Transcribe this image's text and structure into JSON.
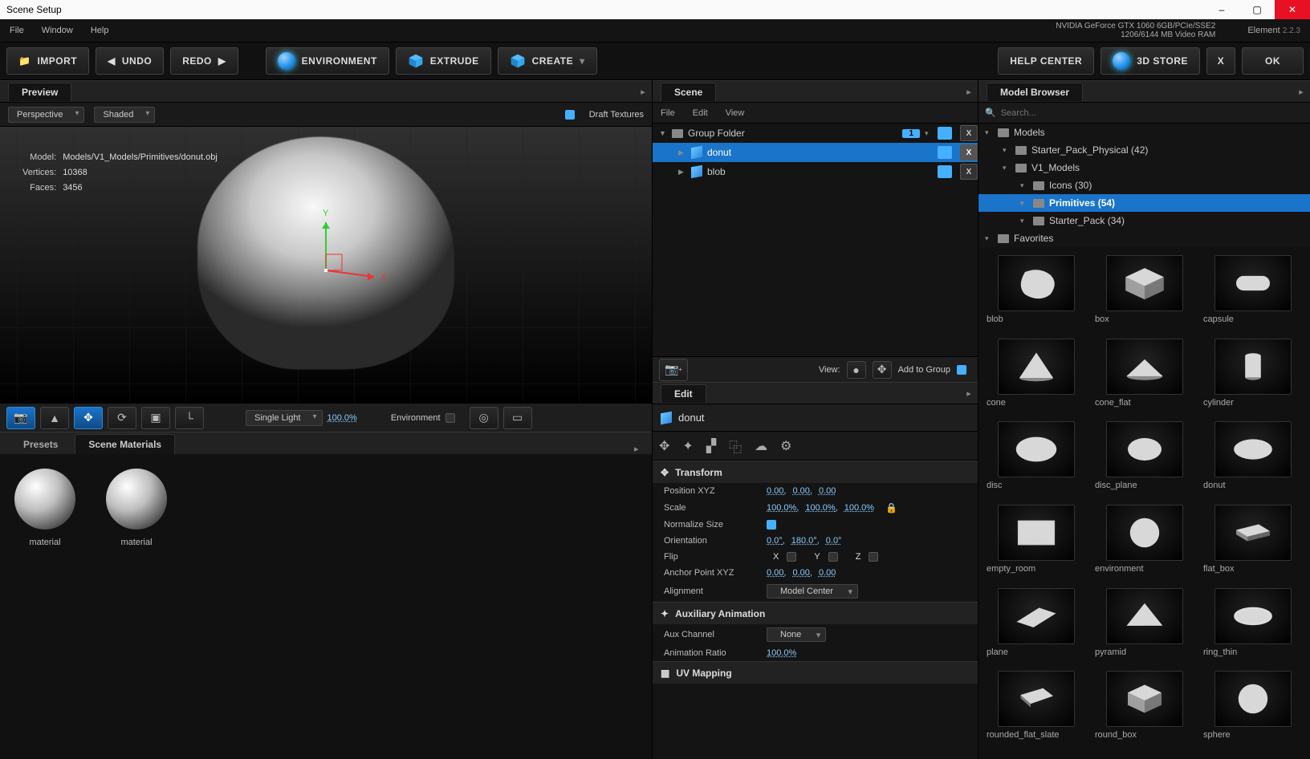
{
  "window": {
    "title": "Scene Setup"
  },
  "menubar": {
    "items": [
      "File",
      "Window",
      "Help"
    ],
    "gpu_line1": "NVIDIA GeForce GTX 1060 6GB/PCIe/SSE2",
    "gpu_line2": "1206/6144 MB Video RAM",
    "product": "Element",
    "version": "2.2.3"
  },
  "toolbar": {
    "import": "IMPORT",
    "undo": "UNDO",
    "redo": "REDO",
    "environment": "ENVIRONMENT",
    "extrude": "EXTRUDE",
    "create": "CREATE",
    "help_center": "HELP CENTER",
    "store": "3D STORE",
    "x": "X",
    "ok": "OK"
  },
  "preview": {
    "tab": "Preview",
    "view_mode": "Perspective",
    "shading": "Shaded",
    "draft_textures": "Draft Textures",
    "info": {
      "model_label": "Model:",
      "model_value": "Models/V1_Models/Primitives/donut.obj",
      "vertices_label": "Vertices:",
      "vertices_value": "10368",
      "faces_label": "Faces:",
      "faces_value": "3456"
    },
    "footer": {
      "lighting": "Single Light",
      "lighting_pct": "100.0%",
      "environment": "Environment"
    }
  },
  "bottom_tabs": {
    "presets": "Presets",
    "materials": "Scene Materials"
  },
  "materials": [
    "material",
    "material"
  ],
  "scene": {
    "tab": "Scene",
    "menu": [
      "File",
      "Edit",
      "View"
    ],
    "tree": [
      {
        "name": "Group Folder",
        "badge": "1",
        "depth": 0,
        "type": "folder",
        "selected": false
      },
      {
        "name": "donut",
        "depth": 1,
        "type": "mesh",
        "selected": true
      },
      {
        "name": "blob",
        "depth": 1,
        "type": "mesh",
        "selected": false
      }
    ],
    "footer": {
      "view": "View:",
      "add": "Add to Group"
    }
  },
  "edit": {
    "tab": "Edit",
    "object": "donut",
    "transform": {
      "header": "Transform",
      "position_label": "Position XYZ",
      "position": [
        "0.00",
        "0.00",
        "0.00"
      ],
      "scale_label": "Scale",
      "scale": [
        "100.0%",
        "100.0%",
        "100.0%"
      ],
      "normalize_label": "Normalize Size",
      "orientation_label": "Orientation",
      "orientation": [
        "0.0°",
        "180.0°",
        "0.0°"
      ],
      "flip_label": "Flip",
      "flip_axes": [
        "X",
        "Y",
        "Z"
      ],
      "anchor_label": "Anchor Point XYZ",
      "anchor": [
        "0.00",
        "0.00",
        "0.00"
      ],
      "alignment_label": "Alignment",
      "alignment": "Model Center"
    },
    "aux": {
      "header": "Auxiliary Animation",
      "channel_label": "Aux Channel",
      "channel": "None",
      "ratio_label": "Animation Ratio",
      "ratio": "100.0%"
    },
    "uv": {
      "header": "UV Mapping"
    }
  },
  "browser": {
    "tab": "Model Browser",
    "search_placeholder": "Search...",
    "tree": [
      {
        "label": "Models",
        "depth": 0
      },
      {
        "label": "Starter_Pack_Physical (42)",
        "depth": 1
      },
      {
        "label": "V1_Models",
        "depth": 1
      },
      {
        "label": "Icons (30)",
        "depth": 2
      },
      {
        "label": "Primitives (54)",
        "depth": 2,
        "selected": true
      },
      {
        "label": "Starter_Pack (34)",
        "depth": 2
      },
      {
        "label": "Favorites",
        "depth": 0
      }
    ],
    "thumbs": [
      "blob",
      "box",
      "capsule",
      "cone",
      "cone_flat",
      "cylinder",
      "disc",
      "disc_plane",
      "donut",
      "empty_room",
      "environment",
      "flat_box",
      "plane",
      "pyramid",
      "ring_thin",
      "rounded_flat_slate",
      "round_box",
      "sphere"
    ]
  }
}
